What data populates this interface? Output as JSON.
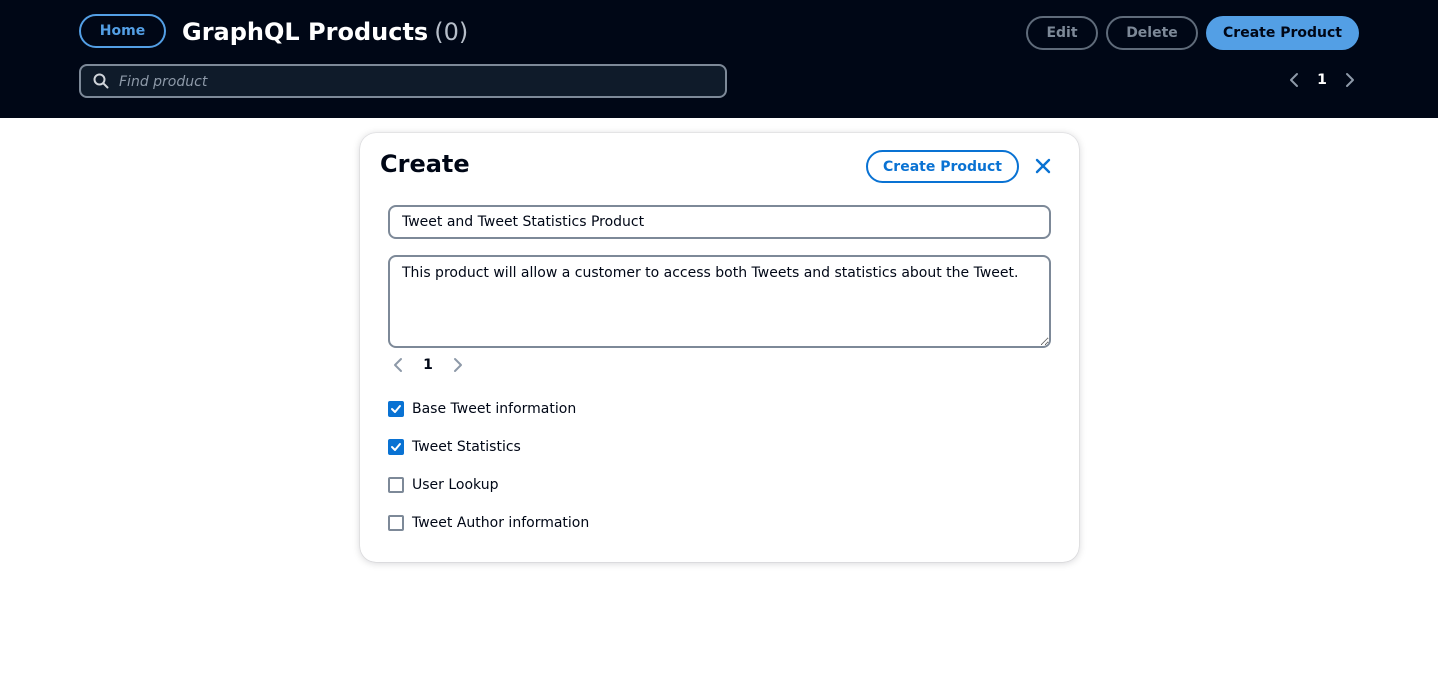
{
  "header": {
    "home_label": "Home",
    "title": "GraphQL Products",
    "count": "(0)",
    "edit_label": "Edit",
    "delete_label": "Delete",
    "create_label": "Create Product",
    "search_placeholder": "Find product",
    "search_value": "",
    "page": "1"
  },
  "modal": {
    "title": "Create",
    "create_label": "Create Product",
    "name_value": "Tweet and Tweet Statistics Product",
    "description_value": "This product will allow a customer to access both Tweets and statistics about the Tweet.",
    "page": "1",
    "options": [
      {
        "label": "Base Tweet information",
        "checked": true
      },
      {
        "label": "Tweet Statistics",
        "checked": true
      },
      {
        "label": "User Lookup",
        "checked": false
      },
      {
        "label": "Tweet Author information",
        "checked": false
      }
    ]
  },
  "colors": {
    "header_bg": "#000716",
    "accent": "#539fe5",
    "primary": "#0972d3"
  },
  "icons": {
    "search": "search-icon",
    "close": "close-icon",
    "prev": "chevron-left-icon",
    "next": "chevron-right-icon",
    "check": "check-icon"
  }
}
